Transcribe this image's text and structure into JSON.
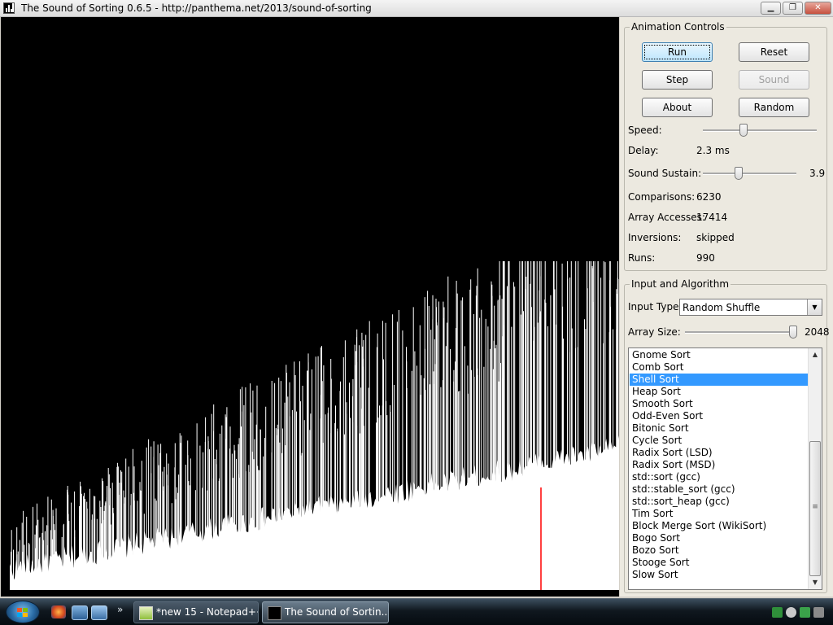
{
  "window": {
    "title": "The Sound of Sorting 0.6.5 - http://panthema.net/2013/sound-of-sorting",
    "minimize_icon": "minimize-icon",
    "maximize_icon": "restore-icon",
    "close_icon": "close-icon"
  },
  "visualization": {
    "element_color": "#ffffff",
    "highlight_color": "#ff0000",
    "background": "#000000",
    "bar_count": 2048
  },
  "animation_controls": {
    "legend": "Animation Controls",
    "buttons": {
      "run": "Run",
      "reset": "Reset",
      "step": "Step",
      "sound": "Sound",
      "about": "About",
      "random": "Random"
    },
    "speed_label": "Speed:",
    "speed_level": 0.36,
    "delay_label": "Delay:",
    "delay_value": "2.3 ms",
    "sustain_label": "Sound Sustain:",
    "sustain_level": 0.38,
    "sustain_value": "3.9",
    "stats": [
      {
        "label": "Comparisons:",
        "value": "6230"
      },
      {
        "label": "Array Accesses:",
        "value": "17414"
      },
      {
        "label": "Inversions:",
        "value": "skipped"
      },
      {
        "label": "Runs:",
        "value": "990"
      }
    ]
  },
  "input_algorithm": {
    "legend": "Input and Algorithm",
    "input_type_label": "Input Type:",
    "input_type_value": "Random Shuffle",
    "array_size_label": "Array Size:",
    "array_size_level": 0.98,
    "array_size_value": "2048",
    "algorithms": [
      "Gnome Sort",
      "Comb Sort",
      "Shell Sort",
      "Heap Sort",
      "Smooth Sort",
      "Odd-Even Sort",
      "Bitonic Sort",
      "Cycle Sort",
      "Radix Sort (LSD)",
      "Radix Sort (MSD)",
      "std::sort (gcc)",
      "std::stable_sort (gcc)",
      "std::sort_heap (gcc)",
      "Tim Sort",
      "Block Merge Sort (WikiSort)",
      "Bogo Sort",
      "Bozo Sort",
      "Stooge Sort",
      "Slow Sort"
    ],
    "selected_algorithm": "Shell Sort"
  },
  "taskbar": {
    "start_icon": "windows-start-icon",
    "quick_launch": [
      "firefox-icon",
      "show-desktop-icon",
      "switch-windows-icon"
    ],
    "tasks": [
      {
        "label": "*new 15 - Notepad++",
        "icon": "notepad-plus-plus-icon",
        "active": false
      },
      {
        "label": "The Sound of Sortin...",
        "icon": "sound-of-sorting-icon",
        "active": true
      }
    ],
    "tray_icons": [
      "network-icon",
      "volume-icon",
      "safely-remove-icon",
      "action-center-icon"
    ]
  }
}
